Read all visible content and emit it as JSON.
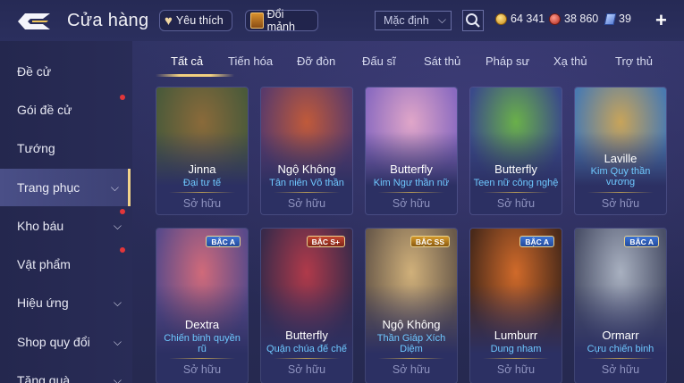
{
  "header": {
    "title": "Cửa hàng",
    "favorite_label": "Yêu thích",
    "exchange_label": "Đổi mảnh",
    "sort_value": "Mặc định",
    "currencies": [
      {
        "icon": "gold-coin-icon",
        "value": "64 341"
      },
      {
        "icon": "ruby-icon",
        "value": "38 860"
      },
      {
        "icon": "voucher-icon",
        "value": "39"
      }
    ]
  },
  "sidebar": {
    "items": [
      {
        "label": "Đề cử",
        "has_dot": false,
        "has_chevron": false,
        "active": false
      },
      {
        "label": "Gói đề cử",
        "has_dot": true,
        "has_chevron": false,
        "active": false
      },
      {
        "label": "Tướng",
        "has_dot": false,
        "has_chevron": false,
        "active": false
      },
      {
        "label": "Trang phục",
        "has_dot": false,
        "has_chevron": true,
        "active": true
      },
      {
        "label": "Kho báu",
        "has_dot": true,
        "has_chevron": true,
        "active": false
      },
      {
        "label": "Vật phẩm",
        "has_dot": true,
        "has_chevron": false,
        "active": false
      },
      {
        "label": "Hiệu ứng",
        "has_dot": false,
        "has_chevron": true,
        "active": false
      },
      {
        "label": "Shop quy đổi",
        "has_dot": false,
        "has_chevron": true,
        "active": false
      },
      {
        "label": "Tặng quà",
        "has_dot": false,
        "has_chevron": true,
        "active": false
      }
    ]
  },
  "tabs": [
    {
      "label": "Tất cả",
      "active": true
    },
    {
      "label": "Tiến hóa",
      "active": false
    },
    {
      "label": "Đỡ đòn",
      "active": false
    },
    {
      "label": "Đấu sĩ",
      "active": false
    },
    {
      "label": "Sát thủ",
      "active": false
    },
    {
      "label": "Pháp sư",
      "active": false
    },
    {
      "label": "Xạ thủ",
      "active": false
    },
    {
      "label": "Trợ thủ",
      "active": false
    }
  ],
  "cards": [
    {
      "name": "Jinna",
      "skin": "Đại tư tế",
      "status": "Sở hữu",
      "badge": "",
      "colors": [
        "#8a6a3a",
        "#4a5a3a"
      ]
    },
    {
      "name": "Ngộ Không",
      "skin": "Tân niên Võ thần",
      "status": "Sở hữu",
      "badge": "",
      "colors": [
        "#c05a3a",
        "#5a3a6a"
      ]
    },
    {
      "name": "Butterfly",
      "skin": "Kim Ngư thần nữ",
      "status": "Sở hữu",
      "badge": "",
      "colors": [
        "#e0a6c8",
        "#8a6ac0"
      ]
    },
    {
      "name": "Butterfly",
      "skin": "Teen nữ công nghệ",
      "status": "Sở hữu",
      "badge": "",
      "colors": [
        "#6ab04a",
        "#3a4a8a"
      ]
    },
    {
      "name": "Laville",
      "skin": "Kim Quy thần vương",
      "status": "Sở hữu",
      "badge": "",
      "colors": [
        "#c8a45a",
        "#4a7ab0"
      ]
    },
    {
      "name": "Dextra",
      "skin": "Chiến binh quyền rũ",
      "status": "Sở hữu",
      "badge": "BẬC A",
      "colors": [
        "#d06a7a",
        "#5a4a8a"
      ]
    },
    {
      "name": "Butterfly",
      "skin": "Quận chúa đế chế",
      "status": "Sở hữu",
      "badge": "BẬC S+",
      "colors": [
        "#b03a4a",
        "#3a2a4a"
      ]
    },
    {
      "name": "Ngộ Không",
      "skin": "Thần Giáp Xích Diệm",
      "status": "Sở hữu",
      "badge": "BẬC SS",
      "colors": [
        "#d0b07a",
        "#6a5a4a"
      ]
    },
    {
      "name": "Lumburr",
      "skin": "Dung nham",
      "status": "Sở hữu",
      "badge": "BẬC A",
      "colors": [
        "#d06a2a",
        "#4a2a1a"
      ]
    },
    {
      "name": "Ormarr",
      "skin": "Cựu chiến binh",
      "status": "Sở hữu",
      "badge": "BẬC A",
      "colors": [
        "#a8b0c0",
        "#4a5068"
      ]
    }
  ]
}
